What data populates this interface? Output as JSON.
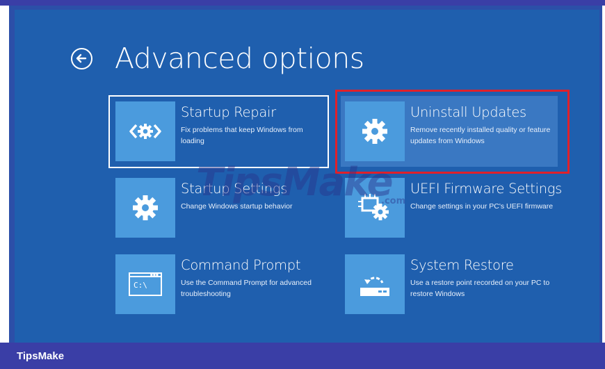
{
  "page": {
    "title": "Advanced options",
    "back_icon": "back-arrow-icon"
  },
  "tiles": [
    {
      "title": "Startup Repair",
      "desc": "Fix problems that keep Windows from loading",
      "icon": "startup-repair-icon"
    },
    {
      "title": "Uninstall Updates",
      "desc": "Remove recently installed quality or feature updates from Windows",
      "icon": "gear-icon"
    },
    {
      "title": "Startup Settings",
      "desc": "Change Windows startup behavior",
      "icon": "gear-icon"
    },
    {
      "title": "UEFI Firmware Settings",
      "desc": "Change settings in your PC's UEFI firmware",
      "icon": "chip-gear-icon"
    },
    {
      "title": "Command Prompt",
      "desc": "Use the Command Prompt for advanced troubleshooting",
      "icon": "command-prompt-icon",
      "icon_text": "C:\\"
    },
    {
      "title": "System Restore",
      "desc": "Use a restore point recorded on your PC to restore Windows",
      "icon": "system-restore-icon"
    }
  ],
  "watermark": {
    "text": "TipsMake",
    "sub": ".com"
  },
  "footer": {
    "label": "TipsMake"
  },
  "colors": {
    "background": "#1f5fae",
    "tile_icon": "#4b9bdd",
    "highlight": "#e0202a",
    "footer": "#3a3ea6"
  }
}
